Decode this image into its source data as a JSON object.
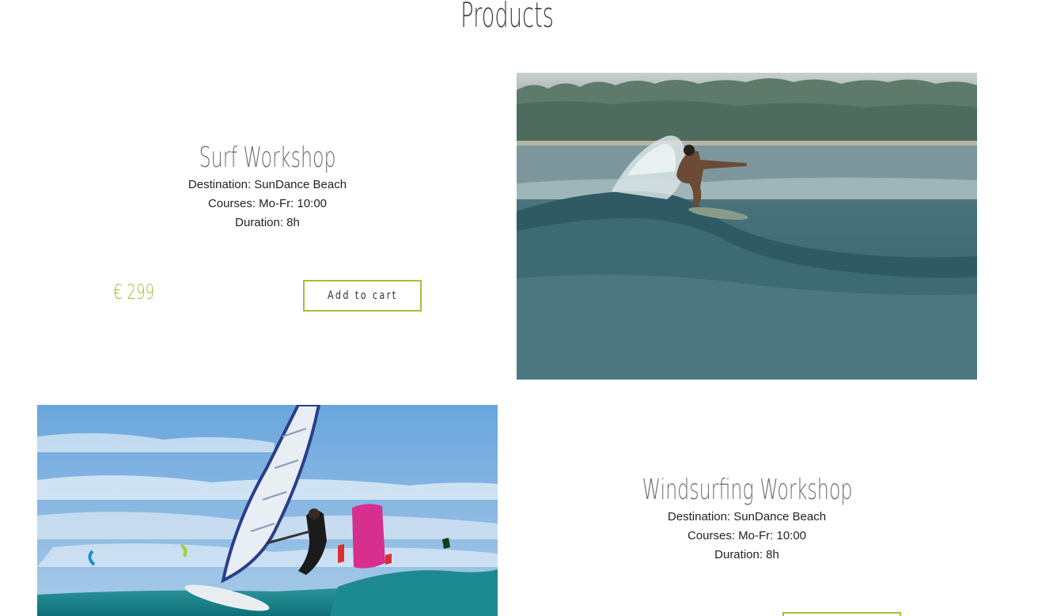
{
  "page": {
    "title": "Products"
  },
  "products": [
    {
      "title": "Surf Workshop",
      "destination": "Destination: SunDance Beach",
      "courses": "Courses: Mo-Fr: 10:00",
      "duration": "Duration: 8h",
      "price": "€ 299",
      "cart_label": "Add to cart",
      "image": "surfer-riding-wave-photo"
    },
    {
      "title": "Windsurfing Workshop",
      "destination": "Destination: SunDance Beach",
      "courses": "Courses: Mo-Fr: 10:00",
      "duration": "Duration: 8h",
      "price": "",
      "cart_label": "",
      "image": "windsurfer-with-kites-photo"
    }
  ],
  "colors": {
    "accent": "#a0c33a",
    "title": "#3f3f3f",
    "product_title": "#707070",
    "text": "#222222"
  }
}
